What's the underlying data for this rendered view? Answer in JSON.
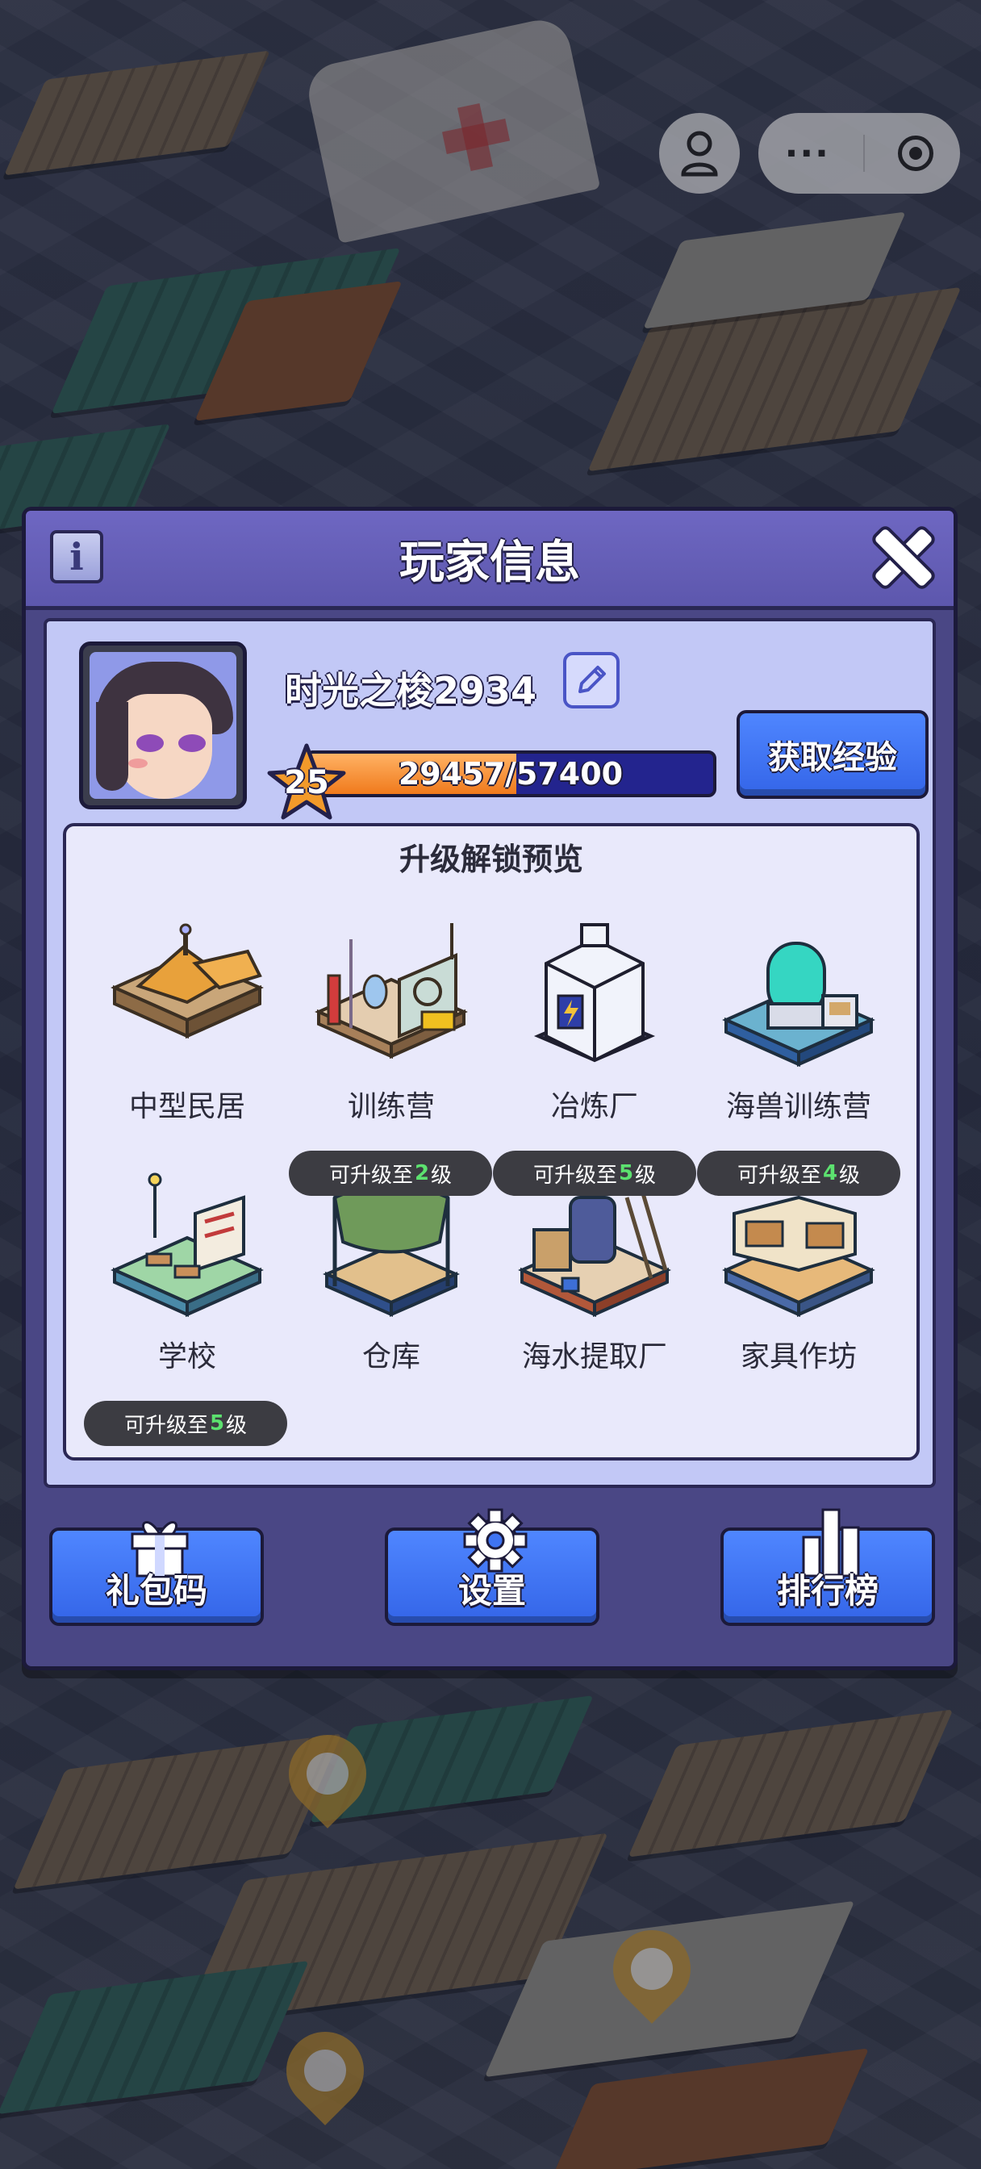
{
  "top_bar": {
    "menu_dots": "···"
  },
  "dialog": {
    "title": "玩家信息",
    "info_button": "i",
    "player": {
      "name": "时光之梭2934",
      "level": "25",
      "xp_text": "29457/57400",
      "xp_current": 29457,
      "xp_max": 57400
    },
    "get_exp_label": "获取经验",
    "preview": {
      "title": "升级解锁预览",
      "buildings": [
        {
          "name": "中型民居",
          "badge": null
        },
        {
          "name": "训练营",
          "badge": null
        },
        {
          "name": "冶炼厂",
          "badge": null
        },
        {
          "name": "海兽训练营",
          "badge": null
        },
        {
          "name": "学校",
          "badge": null
        },
        {
          "name": "仓库",
          "badge": {
            "prefix": "可升级至",
            "level": "2",
            "suffix": "级"
          }
        },
        {
          "name": "海水提取厂",
          "badge": {
            "prefix": "可升级至",
            "level": "5",
            "suffix": "级"
          }
        },
        {
          "name": "家具作坊",
          "badge": {
            "prefix": "可升级至",
            "level": "4",
            "suffix": "级"
          }
        }
      ],
      "partial_badge": {
        "prefix": "可升级至",
        "level": "5",
        "suffix": "级"
      }
    },
    "buttons": {
      "gift_code": "礼包码",
      "settings": "设置",
      "leaderboard": "排行榜"
    }
  },
  "colors": {
    "dialog_bg": "#4a4785",
    "header_bg": "#6e67c2",
    "body_bg": "#c2c8f6",
    "button_blue": "#3f74f2",
    "xp_fill": "#f07a1c",
    "badge_level_green": "#5ce16f"
  }
}
